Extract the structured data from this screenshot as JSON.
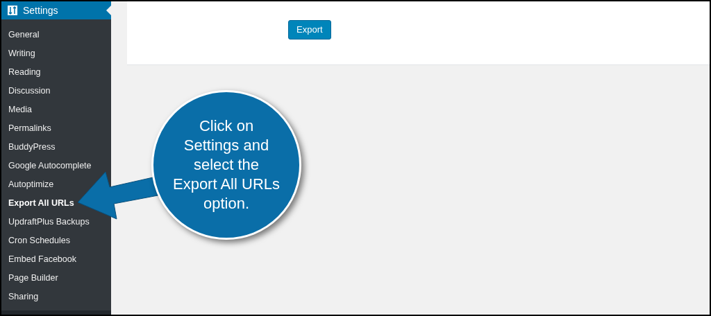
{
  "sidebar": {
    "header": "Settings",
    "items": [
      {
        "label": "General",
        "selected": false
      },
      {
        "label": "Writing",
        "selected": false
      },
      {
        "label": "Reading",
        "selected": false
      },
      {
        "label": "Discussion",
        "selected": false
      },
      {
        "label": "Media",
        "selected": false
      },
      {
        "label": "Permalinks",
        "selected": false
      },
      {
        "label": "BuddyPress",
        "selected": false
      },
      {
        "label": "Google Autocomplete",
        "selected": false
      },
      {
        "label": "Autoptimize",
        "selected": false
      },
      {
        "label": "Export All URLs",
        "selected": true
      },
      {
        "label": "UpdraftPlus Backups",
        "selected": false
      },
      {
        "label": "Cron Schedules",
        "selected": false
      },
      {
        "label": "Embed Facebook",
        "selected": false
      },
      {
        "label": "Page Builder",
        "selected": false
      },
      {
        "label": "Sharing",
        "selected": false
      }
    ]
  },
  "export_button": "Export",
  "callout": {
    "lines": [
      "Click on",
      "Settings and",
      "select the",
      "Export All URLs",
      "option."
    ]
  }
}
